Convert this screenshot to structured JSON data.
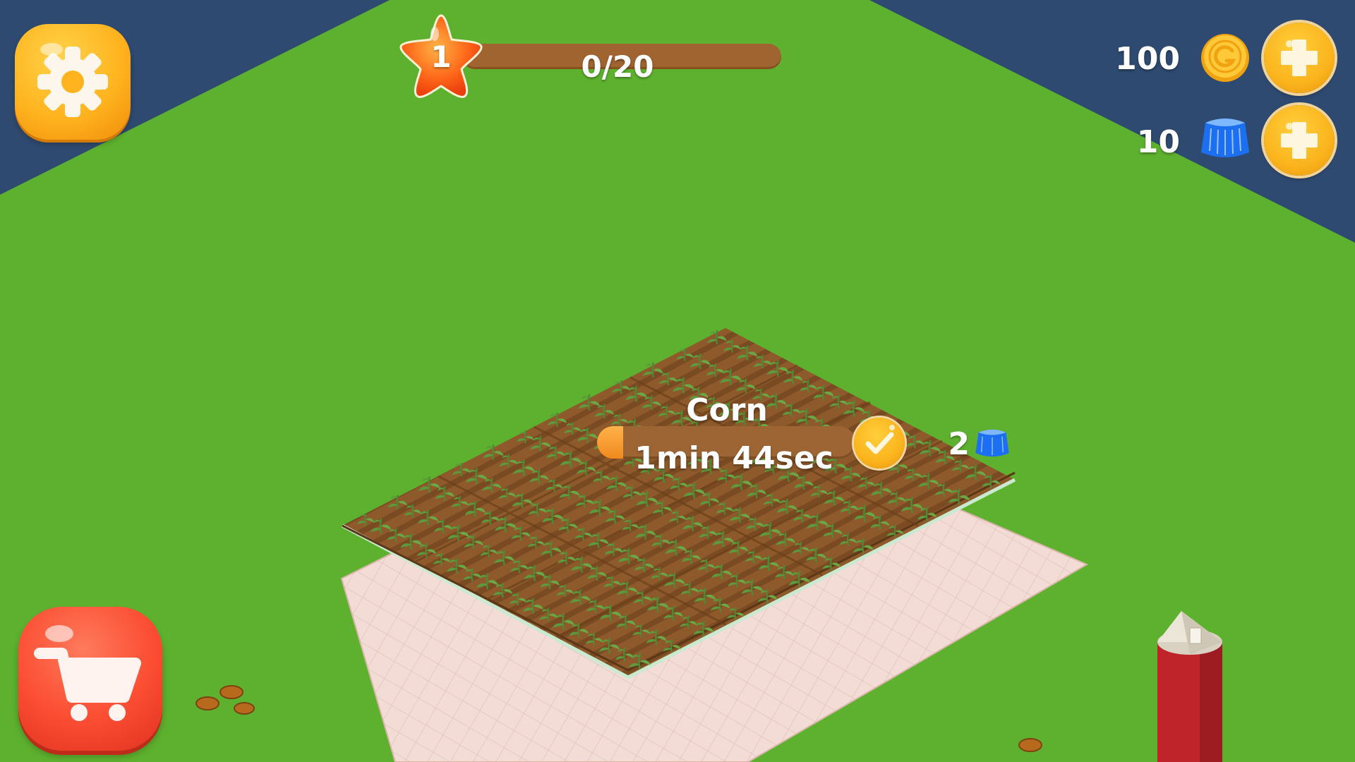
{
  "hud": {
    "level": "1",
    "xp_progress_text": "0/20",
    "xp_progress": 0.0,
    "coins": "100",
    "gems": "10"
  },
  "crop_status": {
    "name": "Corn",
    "time_remaining": "1min 44sec",
    "progress": 0.1,
    "speedup_cost": "2"
  },
  "icons": {
    "settings": "gear-icon",
    "coin": "coin-icon",
    "gem": "gem-icon",
    "add": "plus-icon",
    "harvest": "checkmark-icon",
    "shop": "shopping-cart-icon"
  },
  "colors": {
    "grass": "#5eb12f",
    "background_water": "#2f4a70",
    "soil": "#8b5a2b",
    "pavement": "#f1d6cf",
    "barn_red": "#c0242b",
    "button_orange": "#fbb41c",
    "shop_red": "#fb4d32"
  }
}
